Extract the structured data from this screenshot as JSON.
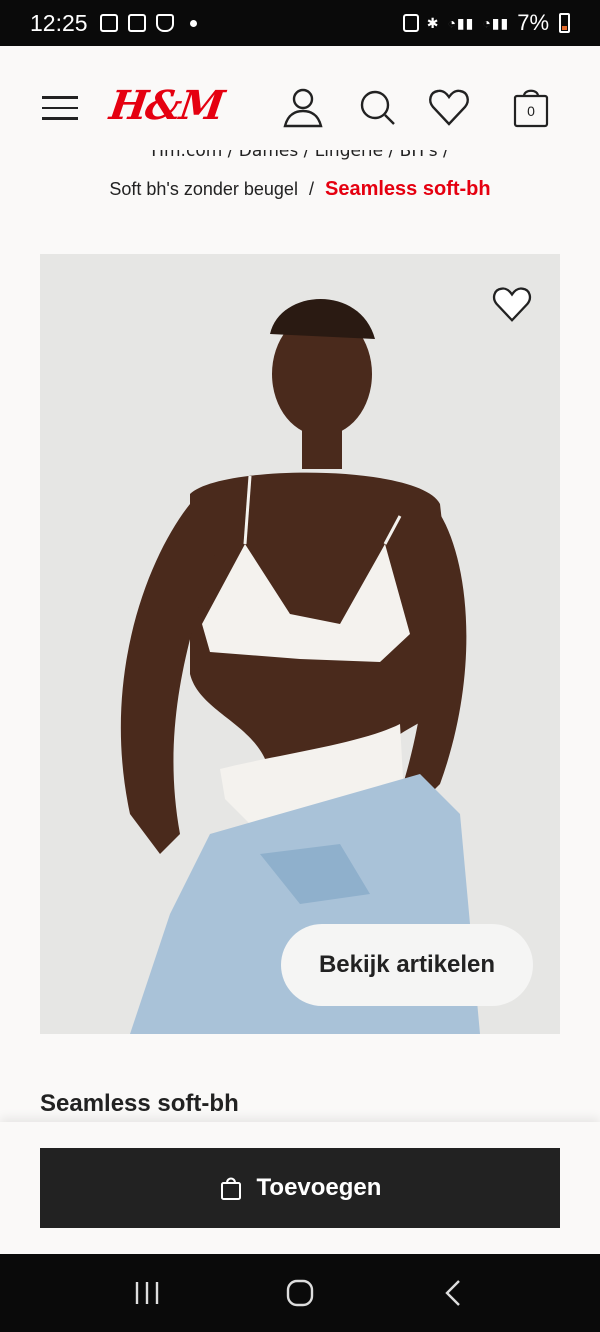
{
  "status_bar": {
    "time": "12:25",
    "battery": "7%",
    "icons": [
      "notification-icon",
      "gallery-icon",
      "shield-icon",
      "dot-icon",
      "sim-icon",
      "bluetooth-icon",
      "wifi-call-icon",
      "signal-icon",
      "battery-icon"
    ]
  },
  "header": {
    "logo": "H&M",
    "bag_count": "0",
    "icons": [
      "menu-icon",
      "user-icon",
      "search-icon",
      "heart-icon",
      "bag-icon"
    ]
  },
  "breadcrumb": {
    "top_line": "Hm.com / Dames / Lingerie / BH's /",
    "parent": "Soft bh's zonder beugel",
    "separator": "/",
    "current": "Seamless soft-bh"
  },
  "product": {
    "image_button": "Bekijk artikelen",
    "title": "Seamless soft-bh",
    "add_button": "Toevoegen"
  },
  "colors": {
    "brand_red": "#e50010",
    "button_dark": "#222222",
    "page_bg": "#faf9f8"
  }
}
